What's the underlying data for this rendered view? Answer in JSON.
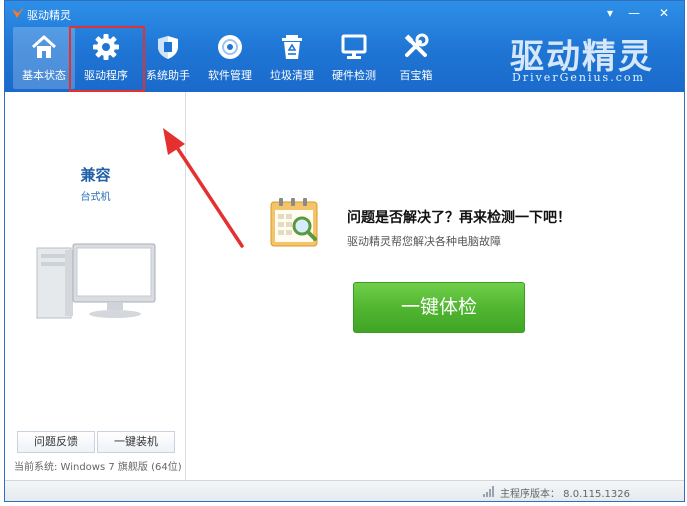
{
  "window": {
    "title": "驱动精灵"
  },
  "titlebar": {
    "menu_glyph": "▾",
    "minimize_glyph": "—",
    "close_glyph": "✕"
  },
  "nav": {
    "items": [
      {
        "label": "基本状态",
        "icon": "home-icon"
      },
      {
        "label": "驱动程序",
        "icon": "gear-icon"
      },
      {
        "label": "系统助手",
        "icon": "shield-icon"
      },
      {
        "label": "软件管理",
        "icon": "disc-icon"
      },
      {
        "label": "垃圾清理",
        "icon": "recycle-bin-icon"
      },
      {
        "label": "硬件检测",
        "icon": "monitor-icon"
      },
      {
        "label": "百宝箱",
        "icon": "tools-icon"
      }
    ],
    "active_index": 0
  },
  "brand": {
    "name": "驱动精灵",
    "subtitle": "DriverGenius.com"
  },
  "sidebar": {
    "title": "兼容",
    "subtitle": "台式机",
    "feedback_button": "问题反馈",
    "install_button": "一键装机",
    "system_info": "当前系统: Windows 7 旗舰版 (64位)"
  },
  "main": {
    "question": "问题是否解决了？再来检测一下吧！",
    "subtext": "驱动精灵帮您解决各种电脑故障",
    "check_button": "一键体检"
  },
  "statusbar": {
    "version": "主程序版本： 8.0.115.1326"
  },
  "colors": {
    "header_blue": "#1f75d4",
    "check_green": "#4fb42f",
    "annotation_red": "#e53030"
  }
}
